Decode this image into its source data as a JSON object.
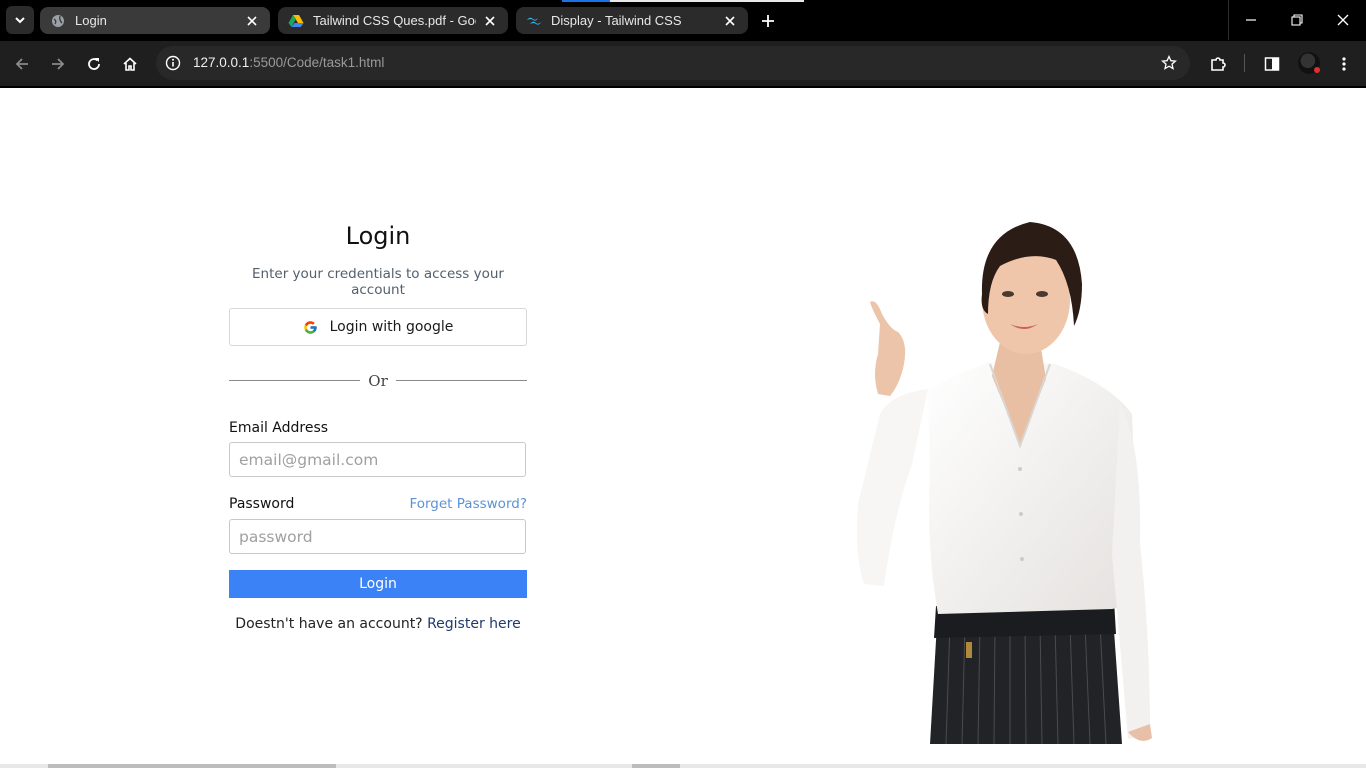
{
  "browser": {
    "tabs": [
      {
        "title": "Login",
        "active": true,
        "icon": "globe-icon"
      },
      {
        "title": "Tailwind CSS Ques.pdf - Google Drive",
        "active": false,
        "icon": "google-drive-icon"
      },
      {
        "title": "Display - Tailwind CSS",
        "active": false,
        "icon": "tailwind-icon"
      }
    ],
    "url_host": "127.0.0.1",
    "url_rest": ":5500/Code/task1.html"
  },
  "login": {
    "title": "Login",
    "subtitle": "Enter your credentials to access your account",
    "google_button": "Login with google",
    "divider": "Or",
    "email_label": "Email Address",
    "email_placeholder": "email@gmail.com",
    "password_label": "Password",
    "forgot_link": "Forget Password?",
    "password_placeholder": "password",
    "submit": "Login",
    "register_prompt": "Doestn't have an account?",
    "register_link": "Register here"
  },
  "colors": {
    "primary_button": "#3b82f6",
    "forgot_link": "#5b93d6",
    "register_link": "#1e3a6f"
  }
}
